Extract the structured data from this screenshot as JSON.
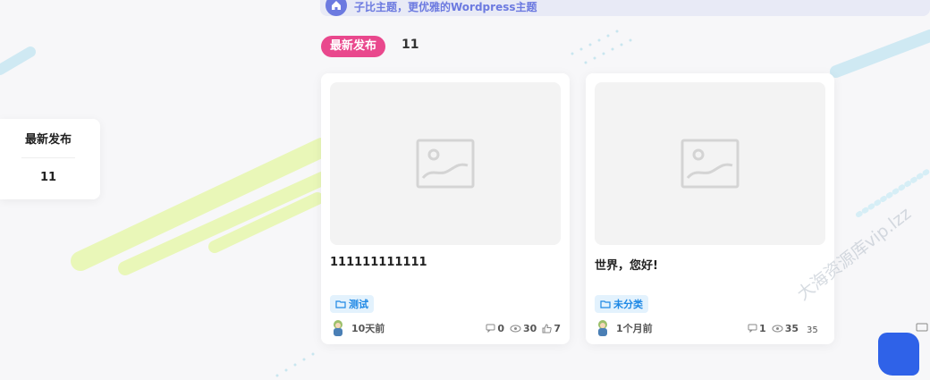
{
  "top_banner": {
    "text": "子比主题，更优雅的Wordpress主题"
  },
  "section": {
    "tag": "最新发布",
    "count": "11"
  },
  "side_widget": {
    "title": "最新发布",
    "count": "11"
  },
  "cards": [
    {
      "title": "111111111111",
      "category": "测试",
      "time": "10天前",
      "comments": "0",
      "views": "30",
      "likes": "7"
    },
    {
      "title": "世界，您好!",
      "category": "未分类",
      "time": "1个月前",
      "comments": "1",
      "views": "35",
      "likes": ""
    }
  ],
  "overlay": {
    "extra_number": "35",
    "watermark": "大海资源库vip.lzz"
  },
  "colors": {
    "accent_pink": "#e9488d",
    "category_blue": "#1e88e5",
    "banner_blue": "#6c7ae0"
  },
  "icons": [
    "home-icon",
    "image-placeholder-icon",
    "folder-icon",
    "comment-icon",
    "eye-icon",
    "thumb-up-icon"
  ]
}
